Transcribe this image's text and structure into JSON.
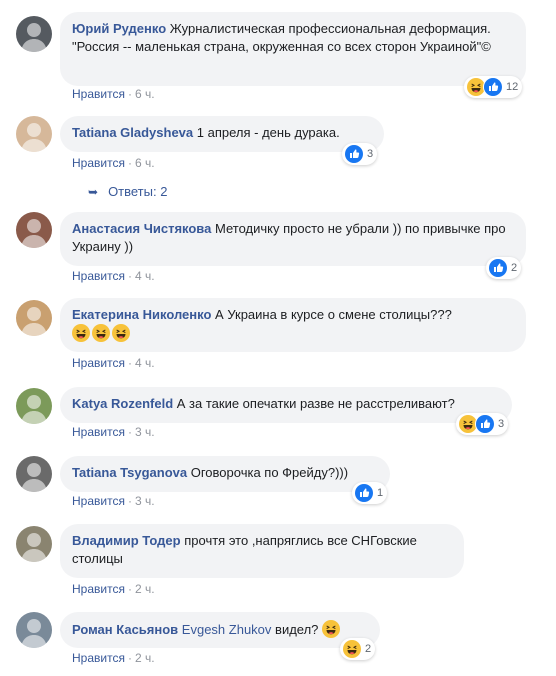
{
  "comments": [
    {
      "author": "Юрий Руденко",
      "text": "Журналистическая профессиональная деформация. \"Россия -- маленькая страна, окруженная со всех сторон Украиной\"©",
      "like": "Нравится",
      "time": "6 ч.",
      "reaction_count": "12",
      "avatar_color": "#555a60"
    },
    {
      "author": "Tatiana Gladysheva",
      "text": "1 апреля - день дурака.",
      "like": "Нравится",
      "time": "6 ч.",
      "reaction_count": "3",
      "avatar_color": "#d6b89a"
    },
    {
      "author": "Анастасия Чистякова",
      "text": "Методичку просто не убрали )) по привычке про Украину ))",
      "like": "Нравится",
      "time": "4 ч.",
      "reaction_count": "2",
      "avatar_color": "#8a5a4a"
    },
    {
      "author": "Екатерина Николенко",
      "text": "А Украина в курсе о смене столицы???",
      "like": "Нравится",
      "time": "4 ч.",
      "reaction_count": "",
      "avatar_color": "#c9a070"
    },
    {
      "author": "Katya Rozenfeld",
      "text": "А за такие опечатки разве не расстреливают?",
      "like": "Нравится",
      "time": "3 ч.",
      "reaction_count": "3",
      "avatar_color": "#7c9a5a"
    },
    {
      "author": "Tatiana Tsyganova",
      "text": "Оговорочка по Фрейду?)))",
      "like": "Нравится",
      "time": "3 ч.",
      "reaction_count": "1",
      "avatar_color": "#6a6a6a"
    },
    {
      "author": "Владимир Тодер",
      "text": "прочтя это ,напряглись все СНГовские столицы",
      "like": "Нравится",
      "time": "2 ч.",
      "reaction_count": "",
      "avatar_color": "#8a8470"
    },
    {
      "author": "Роман Касьянов",
      "mention": "Evgesh Zhukov",
      "text": "видел?",
      "like": "Нравится",
      "time": "2 ч.",
      "reaction_count": "2",
      "avatar_color": "#7a8a99"
    }
  ],
  "replies_label": "Ответы: 2",
  "colors": {
    "link": "#385898",
    "bubble": "#f2f3f5",
    "meta": "#90949c",
    "like_blue": "#1877f2",
    "haha_yellow": "#f7c23a"
  }
}
